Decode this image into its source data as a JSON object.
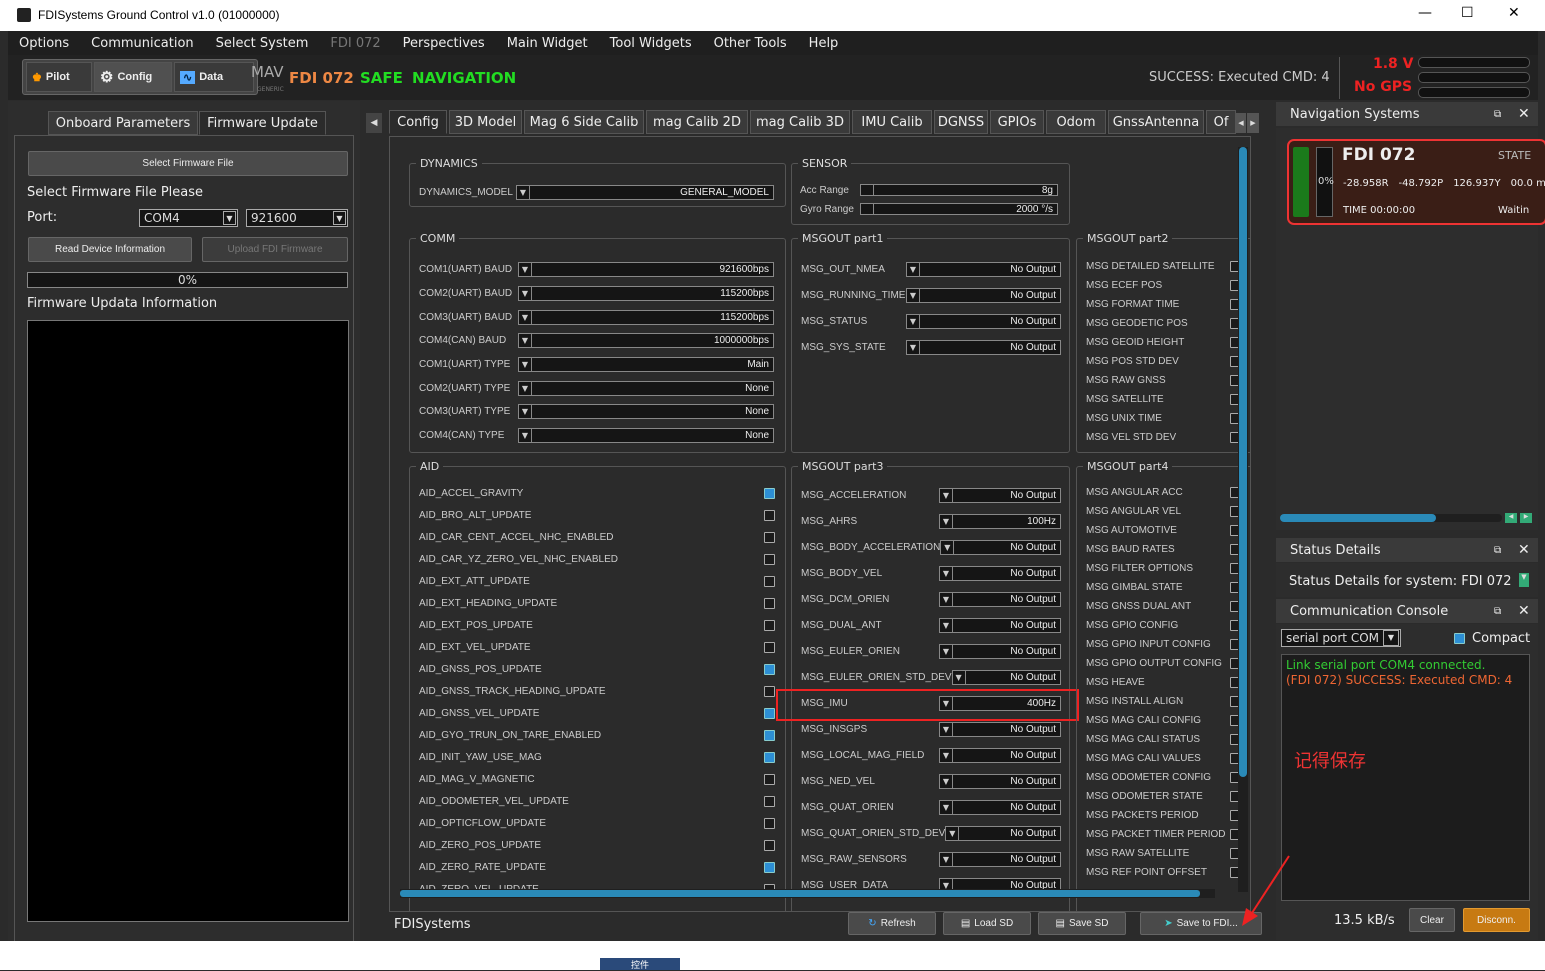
{
  "window": {
    "title": "FDISystems Ground Control v1.0 (01000000)",
    "min": "—",
    "max": "☐",
    "close": "✕"
  },
  "menu": [
    "Options",
    "Communication",
    "Select System",
    "FDI 072",
    "Perspectives",
    "Main Widget",
    "Tool Widgets",
    "Other Tools",
    "Help"
  ],
  "toolbar": {
    "pilot": "Pilot",
    "config": "Config",
    "data": "Data",
    "mav": "MAV",
    "mav_sub": "GENERIC",
    "system": "FDI 072",
    "safe": "SAFE",
    "mode": "NAVIGATION",
    "status": "SUCCESS: Executed CMD: 4",
    "voltage": "1.8 V",
    "gps": "No GPS"
  },
  "left": {
    "tabs": [
      "Onboard Parameters",
      "Firmware Update"
    ],
    "select_btn": "Select Firmware File",
    "prompt": "Select Firmware File Please",
    "port_label": "Port:",
    "port": "COM4",
    "baud": "921600",
    "read_btn": "Read Device Information",
    "upload_btn": "Upload FDI Firmware",
    "progress": "0%",
    "info_label": "Firmware Updata Information"
  },
  "config": {
    "tabs": [
      "Config",
      "3D Model",
      "Mag 6 Side Calib",
      "mag Calib 2D",
      "mag Calib 3D",
      "IMU Calib",
      "DGNSS",
      "GPIOs",
      "Odom",
      "GnssAntenna",
      "Of"
    ],
    "dynamics": {
      "title": "DYNAMICS",
      "label": "DYNAMICS_MODEL",
      "value": "GENERAL_MODEL"
    },
    "sensor": {
      "title": "SENSOR",
      "rows": [
        {
          "label": "Acc Range",
          "value": "8g"
        },
        {
          "label": "Gyro Range",
          "value": "2000 °/s"
        }
      ]
    },
    "comm": {
      "title": "COMM",
      "rows": [
        {
          "label": "COM1(UART) BAUD",
          "value": "921600bps"
        },
        {
          "label": "COM2(UART) BAUD",
          "value": "115200bps"
        },
        {
          "label": "COM3(UART) BAUD",
          "value": "115200bps"
        },
        {
          "label": "COM4(CAN) BAUD",
          "value": "1000000bps"
        },
        {
          "label": "COM1(UART) TYPE",
          "value": "Main"
        },
        {
          "label": "COM2(UART) TYPE",
          "value": "None"
        },
        {
          "label": "COM3(UART) TYPE",
          "value": "None"
        },
        {
          "label": "COM4(CAN) TYPE",
          "value": "None"
        }
      ]
    },
    "part1": {
      "title": "MSGOUT part1",
      "rows": [
        {
          "label": "MSG_OUT_NMEA",
          "value": "No Output"
        },
        {
          "label": "MSG_RUNNING_TIME",
          "value": "No Output"
        },
        {
          "label": "MSG_STATUS",
          "value": "No Output"
        },
        {
          "label": "MSG_SYS_STATE",
          "value": "No Output"
        }
      ]
    },
    "part2": {
      "title": "MSGOUT part2",
      "rows": [
        "MSG DETAILED SATELLITE",
        "MSG ECEF POS",
        "MSG FORMAT TIME",
        "MSG GEODETIC POS",
        "MSG GEOID HEIGHT",
        "MSG POS STD DEV",
        "MSG RAW GNSS",
        "MSG SATELLITE",
        "MSG UNIX TIME",
        "MSG VEL STD DEV"
      ]
    },
    "aid": {
      "title": "AID",
      "rows": [
        {
          "label": "AID_ACCEL_GRAVITY",
          "checked": true
        },
        {
          "label": "AID_BRO_ALT_UPDATE",
          "checked": false
        },
        {
          "label": "AID_CAR_CENT_ACCEL_NHC_ENABLED",
          "checked": false
        },
        {
          "label": "AID_CAR_YZ_ZERO_VEL_NHC_ENABLED",
          "checked": false
        },
        {
          "label": "AID_EXT_ATT_UPDATE",
          "checked": false
        },
        {
          "label": "AID_EXT_HEADING_UPDATE",
          "checked": false
        },
        {
          "label": "AID_EXT_POS_UPDATE",
          "checked": false
        },
        {
          "label": "AID_EXT_VEL_UPDATE",
          "checked": false
        },
        {
          "label": "AID_GNSS_POS_UPDATE",
          "checked": true
        },
        {
          "label": "AID_GNSS_TRACK_HEADING_UPDATE",
          "checked": false
        },
        {
          "label": "AID_GNSS_VEL_UPDATE",
          "checked": true
        },
        {
          "label": "AID_GYO_TRUN_ON_TARE_ENABLED",
          "checked": true
        },
        {
          "label": "AID_INIT_YAW_USE_MAG",
          "checked": true
        },
        {
          "label": "AID_MAG_V_MAGNETIC",
          "checked": false
        },
        {
          "label": "AID_ODOMETER_VEL_UPDATE",
          "checked": false
        },
        {
          "label": "AID_OPTICFLOW_UPDATE",
          "checked": false
        },
        {
          "label": "AID_ZERO_POS_UPDATE",
          "checked": false
        },
        {
          "label": "AID_ZERO_RATE_UPDATE",
          "checked": true
        },
        {
          "label": "AID_ZERO_VEL_UPDATE",
          "checked": false
        }
      ]
    },
    "part3": {
      "title": "MSGOUT part3",
      "rows": [
        {
          "label": "MSG_ACCELERATION",
          "value": "No Output"
        },
        {
          "label": "MSG_AHRS",
          "value": "100Hz"
        },
        {
          "label": "MSG_BODY_ACCELERATION",
          "value": "No Output"
        },
        {
          "label": "MSG_BODY_VEL",
          "value": "No Output"
        },
        {
          "label": "MSG_DCM_ORIEN",
          "value": "No Output"
        },
        {
          "label": "MSG_DUAL_ANT",
          "value": "No Output"
        },
        {
          "label": "MSG_EULER_ORIEN",
          "value": "No Output"
        },
        {
          "label": "MSG_EULER_ORIEN_STD_DEV",
          "value": "No Output"
        },
        {
          "label": "MSG_IMU",
          "value": "400Hz"
        },
        {
          "label": "MSG_INSGPS",
          "value": "No Output"
        },
        {
          "label": "MSG_LOCAL_MAG_FIELD",
          "value": "No Output"
        },
        {
          "label": "MSG_NED_VEL",
          "value": "No Output"
        },
        {
          "label": "MSG_QUAT_ORIEN",
          "value": "No Output"
        },
        {
          "label": "MSG_QUAT_ORIEN_STD_DEV",
          "value": "No Output"
        },
        {
          "label": "MSG_RAW_SENSORS",
          "value": "No Output"
        },
        {
          "label": "MSG_USER_DATA",
          "value": "No Output"
        }
      ]
    },
    "part4": {
      "title": "MSGOUT part4",
      "rows": [
        "MSG ANGULAR ACC",
        "MSG ANGULAR VEL",
        "MSG AUTOMOTIVE",
        "MSG BAUD RATES",
        "MSG FILTER OPTIONS",
        "MSG GIMBAL STATE",
        "MSG GNSS DUAL ANT",
        "MSG GPIO CONFIG",
        "MSG GPIO INPUT CONFIG",
        "MSG GPIO OUTPUT CONFIG",
        "MSG HEAVE",
        "MSG INSTALL ALIGN",
        "MSG MAG CALI CONFIG",
        "MSG MAG CALI STATUS",
        "MSG MAG CALI VALUES",
        "MSG ODOMETER CONFIG",
        "MSG ODOMETER STATE",
        "MSG PACKETS PERIOD",
        "MSG PACKET TIMER PERIOD",
        "MSG RAW SATELLITE",
        "MSG REF POINT OFFSET"
      ]
    },
    "footer": {
      "brand": "FDISystems",
      "refresh": "Refresh",
      "load": "Load SD",
      "save_sd": "Save SD",
      "save_fdi": "Save to FDI..."
    }
  },
  "nav": {
    "title": "Navigation Systems",
    "name": "FDI 072",
    "state": "STATE",
    "pct": "0%",
    "lat": "-28.958R",
    "lon": "-48.792P",
    "alt": "126.937Y",
    "speed": "00.0 m,",
    "time": "TIME 00:00:00",
    "wait": "Waitin"
  },
  "status": {
    "title": "Status Details",
    "text": "Status Details for system: FDI 072"
  },
  "console": {
    "title": "Communication Console",
    "port": "serial port COM",
    "compact": "Compact",
    "line1": "Link serial port COM4 connected.",
    "line2": "(FDI 072) SUCCESS: Executed CMD: 4",
    "rate": "13.5 kB/s",
    "clear": "Clear",
    "disconnect": "Disconn."
  },
  "annotation": "记得保存",
  "taskbar": "控件"
}
